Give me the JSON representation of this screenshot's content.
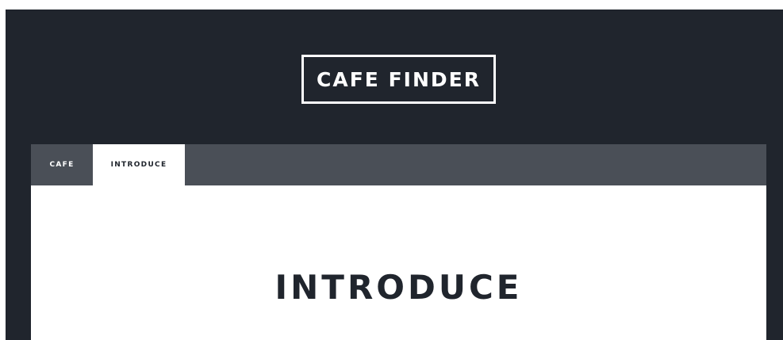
{
  "header": {
    "logo_text": "CAFE FINDER"
  },
  "tabs": [
    {
      "label": "CAFE",
      "active": false
    },
    {
      "label": "INTRODUCE",
      "active": true
    }
  ],
  "main": {
    "heading": "INTRODUCE"
  },
  "colors": {
    "background": "#20252d",
    "tabbar": "#4a4f57",
    "active_tab": "#ffffff",
    "text_dark": "#20252d",
    "text_light": "#ffffff"
  }
}
